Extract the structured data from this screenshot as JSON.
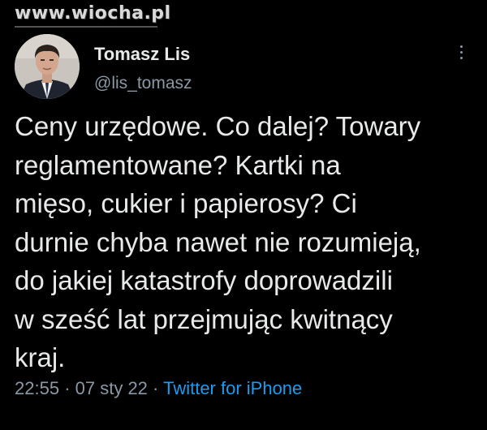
{
  "watermark": "www.wiocha.pl",
  "tweet": {
    "author": {
      "display_name": "Tomasz Lis",
      "handle": "@lis_tomasz"
    },
    "more_icon": "more-vertical-icon",
    "text": "Ceny urzędowe. Co dalej? Towary\nreglamentowane? Kartki na\nmięso, cukier i papierosy? Ci\ndurnie chyba nawet nie rozumieją,\ndo jakiej katastrofy doprowadzili\nw sześć lat przejmując kwitnący\nkraj.",
    "time": "22:55",
    "separator": "·",
    "date": "07 sty 22",
    "source": "Twitter for iPhone"
  },
  "colors": {
    "background": "#000000",
    "text": "#e7e9ea",
    "secondary": "#8b98a5",
    "link": "#1d9bf0"
  }
}
